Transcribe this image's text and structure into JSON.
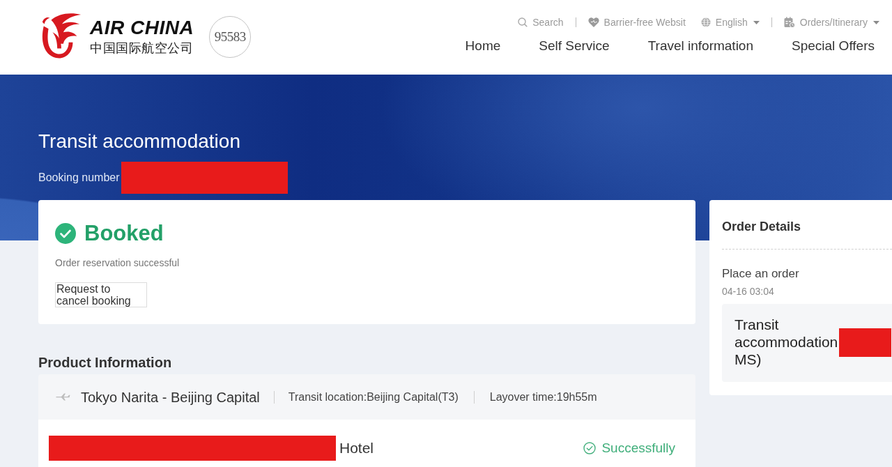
{
  "header": {
    "logo": {
      "wordmark": "AIR CHINA",
      "chinese_name": "中国国际航空公司",
      "hotline": "95583"
    },
    "utility_groups": [
      {
        "links": [
          {
            "kind": "search",
            "label": "Search",
            "dropdown": false
          }
        ]
      },
      {
        "links": [
          {
            "kind": "accessibility",
            "label": "Barrier-free Websit",
            "dropdown": false
          },
          {
            "kind": "language",
            "label": "English",
            "dropdown": true
          }
        ]
      },
      {
        "links": [
          {
            "kind": "orders",
            "label": "Orders/Itinerary",
            "dropdown": true
          }
        ]
      }
    ],
    "nav": [
      "Home",
      "Self Service",
      "Travel information",
      "Special Offers"
    ]
  },
  "banner": {
    "title": "Transit accommodation",
    "booking_number_label": "Booking number"
  },
  "status_card": {
    "status": "Booked",
    "message": "Order reservation successful",
    "cancel_button": "Request to cancel booking"
  },
  "product_information": {
    "heading": "Product Information",
    "route": "Tokyo Narita - Beijing Capital",
    "transit_location": "Transit location:Beijing Capital(T3)",
    "layover_time": "Layover time:19h55m",
    "hotel": {
      "name": "Hotel",
      "status": "Successfully"
    }
  },
  "order_details": {
    "title": "Order Details",
    "steps": [
      {
        "label": "Place an order",
        "time": "04-16 03:04",
        "item_text": "Transit accommodation",
        "item_text_end": "MS)"
      }
    ]
  }
}
